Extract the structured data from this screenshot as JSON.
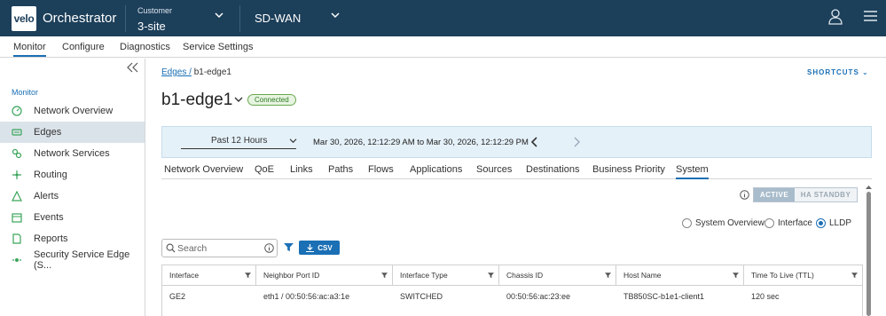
{
  "header": {
    "logo_text": "velo",
    "app_name": "Orchestrator",
    "customer_label": "Customer",
    "customer_value": "3-site",
    "product": "SD-WAN",
    "bg_color": "#1c3f5a"
  },
  "top_tabs": [
    {
      "label": "Monitor",
      "active": true
    },
    {
      "label": "Configure",
      "active": false
    },
    {
      "label": "Diagnostics",
      "active": false
    },
    {
      "label": "Service Settings",
      "active": false
    }
  ],
  "sidebar": {
    "heading": "Monitor",
    "items": [
      {
        "label": "Network Overview",
        "icon": "gauge-icon"
      },
      {
        "label": "Edges",
        "icon": "edge-device-icon",
        "active": true
      },
      {
        "label": "Network Services",
        "icon": "network-services-icon"
      },
      {
        "label": "Routing",
        "icon": "routing-icon"
      },
      {
        "label": "Alerts",
        "icon": "alert-icon"
      },
      {
        "label": "Events",
        "icon": "calendar-icon"
      },
      {
        "label": "Reports",
        "icon": "report-icon"
      },
      {
        "label": "Security Service Edge (S...",
        "icon": "sse-icon"
      }
    ]
  },
  "breadcrumb": {
    "parent": "Edges /",
    "current": "b1-edge1"
  },
  "shortcuts_label": "SHORTCUTS",
  "edge": {
    "name": "b1-edge1",
    "status": "Connected"
  },
  "time": {
    "selected": "Past 12 Hours",
    "range": "Mar 30, 2026, 12:12:29 AM to Mar 30, 2026, 12:12:29 PM"
  },
  "sub_tabs": [
    {
      "label": "Network Overview"
    },
    {
      "label": "QoE"
    },
    {
      "label": "Links"
    },
    {
      "label": "Paths"
    },
    {
      "label": "Flows"
    },
    {
      "label": "Applications"
    },
    {
      "label": "Sources"
    },
    {
      "label": "Destinations"
    },
    {
      "label": "Business Priority"
    },
    {
      "label": "System",
      "active": true
    }
  ],
  "ha_toggle": {
    "active": "ACTIVE",
    "standby": "HA STANDBY"
  },
  "view_options": [
    {
      "label": "System Overview",
      "selected": false
    },
    {
      "label": "Interface",
      "selected": false
    },
    {
      "label": "LLDP",
      "selected": true
    }
  ],
  "search": {
    "placeholder": "Search"
  },
  "csv_label": "CSV",
  "table": {
    "columns": [
      "Interface",
      "Neighbor Port ID",
      "Interface Type",
      "Chassis ID",
      "Host Name",
      "Time To Live (TTL)"
    ],
    "rows": [
      [
        "GE2",
        "eth1 / 00:50:56:ac:a3:1e",
        "SWITCHED",
        "00:50:56:ac:23:ee",
        "TB850SC-b1e1-client1",
        "120 sec"
      ]
    ]
  },
  "colors": {
    "accent": "#1a6fb5",
    "status_green": "#2d7a20",
    "timebar_bg": "#e5f1f9"
  }
}
